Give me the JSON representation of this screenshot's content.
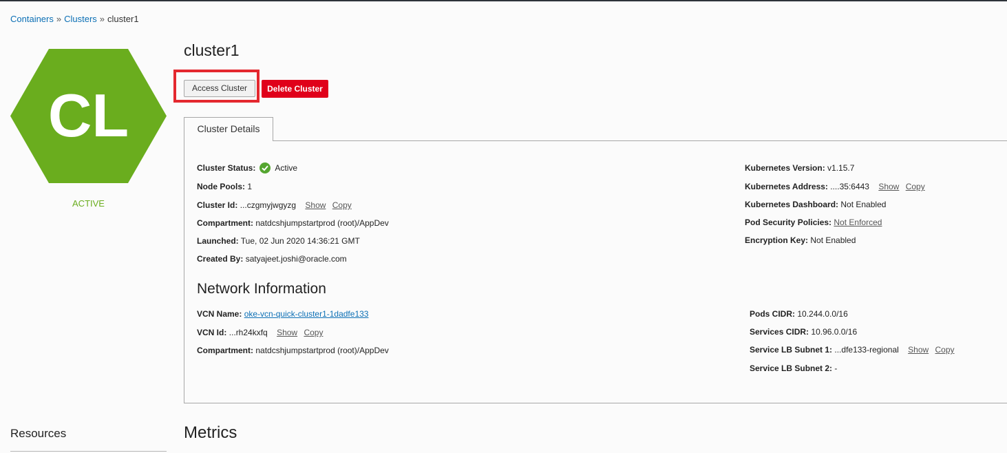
{
  "breadcrumb": {
    "item1": "Containers",
    "sep1": "»",
    "item2": "Clusters",
    "sep2": "»",
    "current": "cluster1"
  },
  "hex": {
    "initials": "CL",
    "color": "#6aad1e"
  },
  "status_label": "ACTIVE",
  "title": "cluster1",
  "buttons": {
    "access": "Access Cluster",
    "delete": "Delete Cluster"
  },
  "tab": "Cluster Details",
  "details_left": {
    "status_key": "Cluster Status:",
    "status_val": "Active",
    "node_pools_key": "Node Pools:",
    "node_pools_val": "1",
    "cluster_id_key": "Cluster Id:",
    "cluster_id_val": "...czgmyjwgyzg",
    "compartment_key": "Compartment:",
    "compartment_val": "natdcshjumpstartprod (root)/AppDev",
    "launched_key": "Launched:",
    "launched_val": "Tue, 02 Jun 2020 14:36:21 GMT",
    "created_key": "Created By:",
    "created_val": "satyajeet.joshi@oracle.com"
  },
  "details_right": {
    "k8s_version_key": "Kubernetes Version:",
    "k8s_version_val": "v1.15.7",
    "k8s_address_key": "Kubernetes Address:",
    "k8s_address_val": "....35:6443",
    "k8s_dashboard_key": "Kubernetes Dashboard:",
    "k8s_dashboard_val": "Not Enabled",
    "psp_key": "Pod Security Policies:",
    "psp_val": "Not Enforced",
    "enc_key": "Encryption Key:",
    "enc_val": "Not Enabled"
  },
  "links": {
    "show": "Show",
    "copy": "Copy"
  },
  "network": {
    "heading": "Network Information",
    "vcn_name_key": "VCN Name:",
    "vcn_name_val": "oke-vcn-quick-cluster1-1dadfe133",
    "vcn_id_key": "VCN Id:",
    "vcn_id_val": "...rh24kxfq",
    "compartment_key": "Compartment:",
    "compartment_val": "natdcshjumpstartprod (root)/AppDev",
    "pods_cidr_key": "Pods CIDR:",
    "pods_cidr_val": "10.244.0.0/16",
    "services_cidr_key": "Services CIDR:",
    "services_cidr_val": "10.96.0.0/16",
    "lb1_key": "Service LB Subnet 1:",
    "lb1_val": "...dfe133-regional",
    "lb2_key": "Service LB Subnet 2:",
    "lb2_val": "-"
  },
  "resources_heading": "Resources",
  "metrics_heading": "Metrics",
  "colors": {
    "accent_link": "#0b6fb5",
    "danger": "#e0001a",
    "success": "#55a630"
  }
}
